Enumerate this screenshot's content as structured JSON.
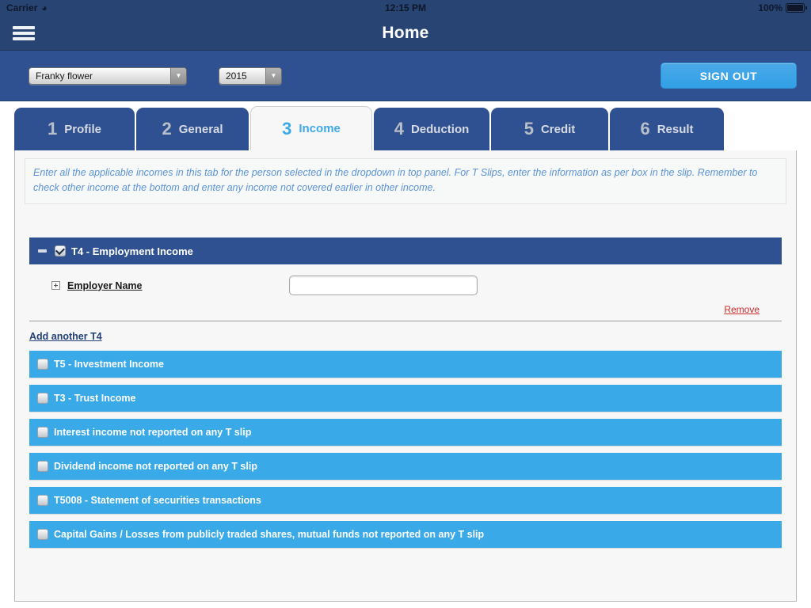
{
  "statusbar": {
    "carrier": "Carrier",
    "wifi_icon": "wifi-icon",
    "time": "12:15 PM",
    "battery_percent": "100%"
  },
  "navbar": {
    "menu_icon": "hamburger-menu-icon",
    "title": "Home"
  },
  "toolbar": {
    "person_select": {
      "value": "Franky flower",
      "arrow_icon": "chevron-down-icon"
    },
    "year_select": {
      "value": "2015",
      "arrow_icon": "chevron-down-icon"
    },
    "sign_out_label": "SIGN OUT"
  },
  "tabs": [
    {
      "num": "1",
      "label": "Profile",
      "active": false
    },
    {
      "num": "2",
      "label": "General",
      "active": false
    },
    {
      "num": "3",
      "label": "Income",
      "active": true
    },
    {
      "num": "4",
      "label": "Deduction",
      "active": false
    },
    {
      "num": "5",
      "label": "Credit",
      "active": false
    },
    {
      "num": "6",
      "label": "Result",
      "active": false
    }
  ],
  "content": {
    "note": "Enter all the applicable incomes in this tab for the person selected in the dropdown in top panel. For T Slips, enter the information as per box in the slip. Remember to check other income at the bottom and enter any income not covered earlier in other income.",
    "t4_section": {
      "title": "T4 - Employment Income",
      "collapse_icon": "minus-icon",
      "checkbox_state": "checked",
      "employer_field": {
        "label": "Employer Name",
        "expand_icon": "plus-icon",
        "value": "",
        "placeholder": ""
      },
      "remove_label": "Remove",
      "add_another_label": "Add another T4"
    },
    "income_sections": [
      {
        "title": "T5 - Investment Income",
        "checkbox_state": "unchecked"
      },
      {
        "title": "T3 - Trust Income",
        "checkbox_state": "unchecked"
      },
      {
        "title": "Interest income not reported on any T slip",
        "checkbox_state": "unchecked"
      },
      {
        "title": "Dividend income not reported on any T slip",
        "checkbox_state": "unchecked"
      },
      {
        "title": "T5008 - Statement of securities transactions",
        "checkbox_state": "unchecked"
      },
      {
        "title": "Capital Gains / Losses from publicly traded shares, mutual funds not reported on any T slip",
        "checkbox_state": "unchecked"
      }
    ]
  },
  "colors": {
    "navbar": "#274472",
    "toolbar": "#2F5191",
    "accent_blue": "#39A9E8",
    "note_text": "#5b93d6",
    "remove_link": "#cc2b2b",
    "add_link": "#24407a"
  }
}
